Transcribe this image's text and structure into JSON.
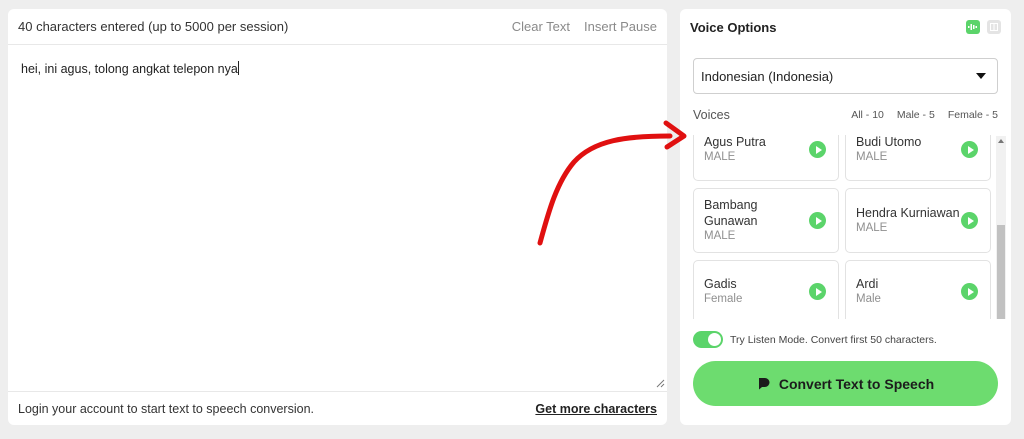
{
  "editor": {
    "char_count": "40 characters entered (up to 5000 per session)",
    "clear_text": "Clear Text",
    "insert_pause": "Insert Pause",
    "text": "hei, ini agus, tolong angkat telepon nya",
    "login_note": "Login your account to start text to speech conversion.",
    "get_more": "Get more characters"
  },
  "voice_options": {
    "title": "Voice Options",
    "header_icons": [
      "waveform-icon",
      "panel-icon"
    ],
    "language": "Indonesian (Indonesia)",
    "voices_label": "Voices",
    "filters": [
      "All - 10",
      "Male - 5",
      "Female - 5"
    ],
    "voices": [
      {
        "name": "Agus Putra",
        "gender": "MALE"
      },
      {
        "name": "Budi Utomo",
        "gender": "MALE"
      },
      {
        "name": "Bambang Gunawan",
        "gender": "MALE"
      },
      {
        "name": "Hendra Kurniawan",
        "gender": "MALE"
      },
      {
        "name": "Gadis",
        "gender": "Female"
      },
      {
        "name": "Ardi",
        "gender": "Male"
      }
    ],
    "listen_mode": "Try Listen Mode. Convert first 50 characters.",
    "listen_mode_on": true,
    "convert_label": "Convert Text to Speech"
  },
  "colors": {
    "accent_green": "#5bd46a",
    "button_green": "#6ddc6f",
    "annotation_red": "#e01010"
  }
}
